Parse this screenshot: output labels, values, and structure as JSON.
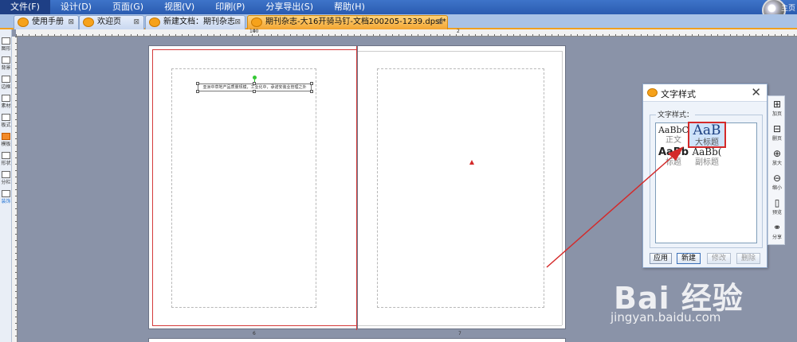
{
  "menubar": {
    "items": [
      "文件(F)",
      "设计(D)",
      "页面(G)",
      "视图(V)",
      "印刷(P)",
      "分享导出(S)",
      "帮助(H)"
    ],
    "orb_label": "主页"
  },
  "tabs": [
    {
      "label": "使用手册",
      "close": "⊠"
    },
    {
      "label": "欢迎页",
      "close": "⊠"
    },
    {
      "label": "新建文档：期刊杂志",
      "close": "⊠"
    },
    {
      "label": "期刊杂志-大16开骑马钉-文档200205-1239.dpsf*",
      "close": "⊠"
    }
  ],
  "ruler": {
    "numbers": [
      "4",
      "100",
      "2"
    ]
  },
  "left_toolbar": {
    "items": [
      "图形",
      "背景",
      "边框",
      "素材",
      "板式",
      "模板",
      "形状",
      "分栏",
      "装饰"
    ]
  },
  "document": {
    "text_frame": "亚洲中草地产品质量规模，工业化中，承诺安装业管理之外",
    "page_numbers": [
      "6",
      "7"
    ]
  },
  "dialog": {
    "title": "文字样式",
    "close": "✕",
    "group_label": "文字样式：",
    "styles": [
      {
        "sample": "AaBbC",
        "name": "正文"
      },
      {
        "sample": "AaB",
        "name": "大标题"
      },
      {
        "sample": "AaBb",
        "name": "标题"
      },
      {
        "sample": "AaBb(",
        "name": "副标题"
      }
    ],
    "buttons": [
      "应用",
      "新建",
      "修改",
      "删除"
    ]
  },
  "right_toolbar": {
    "items": [
      {
        "glyph": "⊞",
        "label": "加页"
      },
      {
        "glyph": "⊟",
        "label": "删页"
      },
      {
        "glyph": "⊕",
        "label": "放大"
      },
      {
        "glyph": "⊖",
        "label": "缩小"
      },
      {
        "glyph": "▯",
        "label": "预览"
      },
      {
        "glyph": "⚭",
        "label": "分享"
      }
    ]
  },
  "watermark": {
    "text": "Bai 经验",
    "url": "jingyan.baidu.com"
  },
  "colors": {
    "menubar": "#2a5bb0",
    "active_tab": "#f3a531",
    "highlight_red": "#d42a2a"
  }
}
